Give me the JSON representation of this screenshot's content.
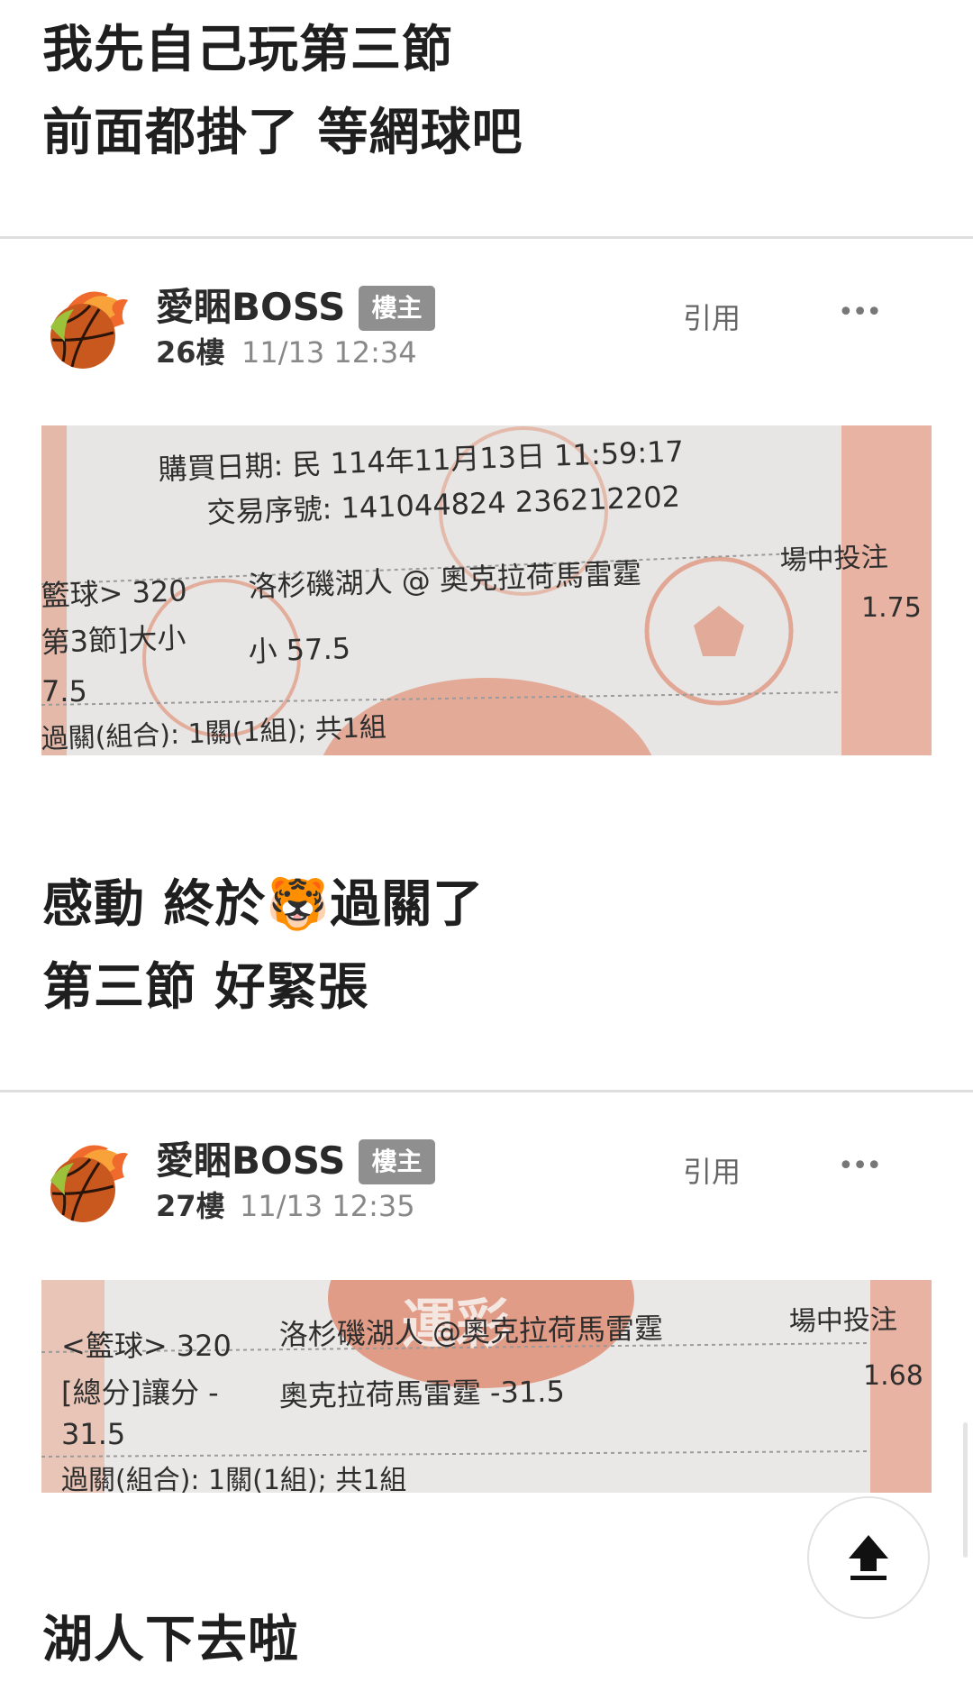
{
  "posts": [
    {
      "lines": [
        "我先自己玩第三節",
        "前面都掛了 等網球吧"
      ]
    },
    {
      "author": "愛睏BOSS",
      "badge": "樓主",
      "floor": "26樓",
      "time": "11/13 12:34",
      "quote_label": "引用",
      "more_label": "•••",
      "ticket": {
        "purchase_date": "購買日期: 民  114年11月13日  11:59:17",
        "serial": "交易序號: 141044824 236212202",
        "game": "籃球> 320",
        "match": "洛杉磯湖人  @ 奧克拉荷馬雷霆",
        "bet_type": "場中投注",
        "market": "第3節]大小",
        "selection": "小  57.5",
        "odds": "1.75",
        "line": "7.5",
        "combo": "過關(組合): 1關(1組); 共1組"
      },
      "lines": [
        "感動 終於🐯過關了",
        "第三節 好緊張"
      ]
    },
    {
      "author": "愛睏BOSS",
      "badge": "樓主",
      "floor": "27樓",
      "time": "11/13 12:35",
      "quote_label": "引用",
      "more_label": "•••",
      "ticket": {
        "game": "<籃球> 320",
        "match": "洛杉磯湖人 @奧克拉荷馬雷霆",
        "bet_type": "場中投注",
        "market": "[總分]讓分  -",
        "selection": "奧克拉荷馬雷霆  -31.5",
        "odds": "1.68",
        "line": "31.5",
        "combo": "過關(組合): 1關(1組); 共1組"
      },
      "lines": [
        "湖人下去啦"
      ]
    }
  ],
  "scroll_top_icon": "upload-arrow-icon"
}
